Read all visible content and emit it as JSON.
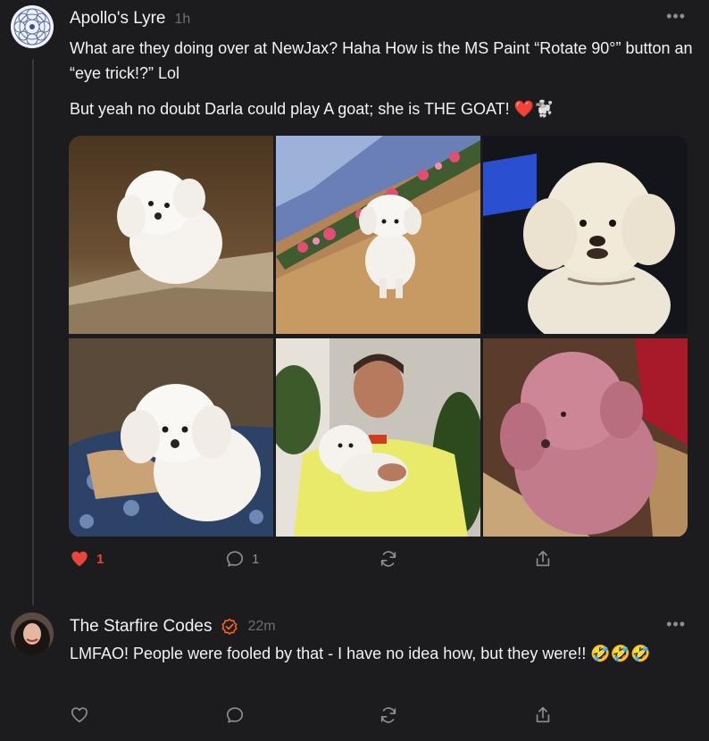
{
  "post1": {
    "author": "Apollo's Lyre",
    "time": "1h",
    "more": "•••",
    "paragraph1": "What are they doing over at NewJax? Haha How is the MS Paint “Rotate 90°” button an “eye trick!?” Lol",
    "paragraph2": "But yeah no doubt Darla could play A goat; she is THE GOAT! ❤️🐩",
    "images": [
      "white poodle on rocks",
      "white poodle on hay by flowers",
      "white poodle close-up",
      "white poodle on patterned cushion",
      "man in yellow cardigan holding poodle",
      "pink poodle"
    ],
    "likes": "1",
    "comments": "1",
    "liked": true,
    "accent_color": "#e8453c"
  },
  "post2": {
    "author": "The Starfire Codes",
    "time": "22m",
    "more": "•••",
    "text": "LMFAO! People were fooled by that - I have no idea how, but they were!! 🤣🤣🤣",
    "verified_color": "#ff6719"
  },
  "icons": [
    "heart-icon",
    "comment-icon",
    "restack-icon",
    "share-icon",
    "verified-icon",
    "more-icon"
  ]
}
